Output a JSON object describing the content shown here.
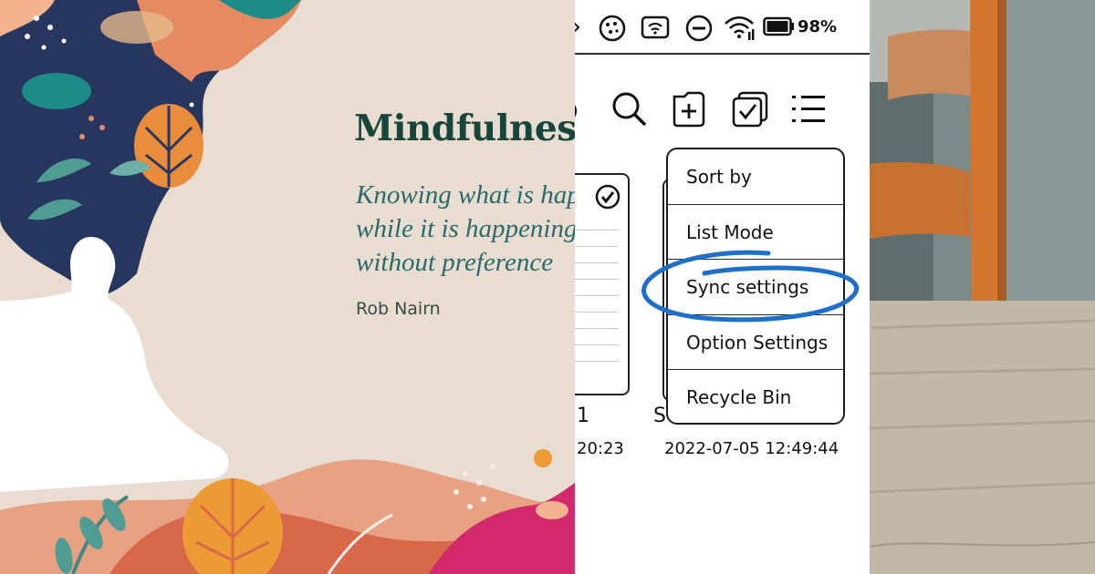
{
  "poster": {
    "title": "Mindfulness",
    "quote_lines": [
      "Knowing what is happening",
      "while it is happening",
      "without preference"
    ],
    "author": "Rob Nairn"
  },
  "device": {
    "battery": "98%",
    "status_icons": [
      "cookie-icon",
      "wifi-hotspot-icon",
      "do-not-disturb-icon",
      "wifi-icon",
      "battery-icon"
    ],
    "toolbar_icons": [
      "search-icon",
      "new-folder-icon",
      "multi-select-icon",
      "menu-list-icon"
    ],
    "menu": {
      "items": [
        "Sort by",
        "List Mode",
        "Sync settings",
        "Option Settings",
        "Recycle Bin"
      ],
      "highlighted": "Sync settings"
    },
    "files": [
      {
        "name": "1",
        "date": "20:23"
      },
      {
        "name": "S",
        "date": "2022-07-05 12:49:44"
      }
    ]
  },
  "colors": {
    "highlight_ring": "#1f6fc9",
    "poster_title": "#18453b",
    "poster_quote": "#2b6a6a"
  }
}
